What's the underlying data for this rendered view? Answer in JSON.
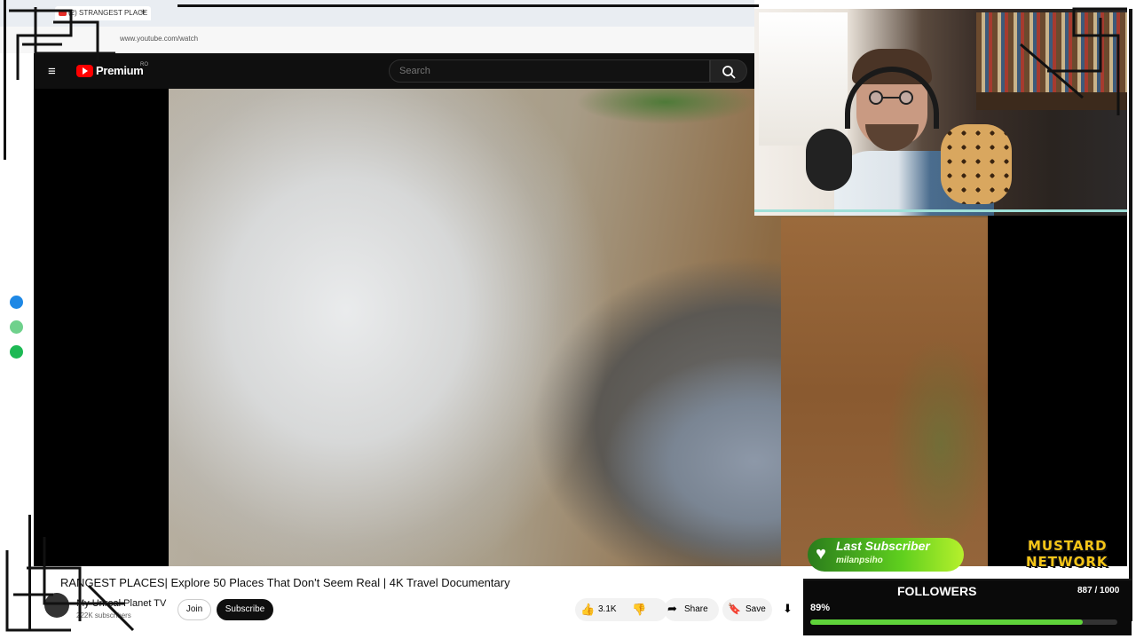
{
  "browser": {
    "tab_title": "(2) STRANGEST PLACE",
    "new_tab": "+",
    "url": "www.youtube.com/watch"
  },
  "youtube": {
    "menu_icon": "≡",
    "logo_text": "Premium",
    "region": "RO",
    "search_placeholder": "Search",
    "video_title": "RANGEST PLACES| Explore 50 Places That Don't Seem Real | 4K Travel Documentary",
    "channel_name": "My Unreal Planet TV",
    "subscribers": "222K subscribers",
    "join_label": "Join",
    "subscribe_label": "Subscribe",
    "likes": "3.1K",
    "share_label": "Share",
    "save_label": "Save"
  },
  "overlay": {
    "last_subscriber_title": "Last Subscriber",
    "last_subscriber_name": "milanpsiho",
    "brand_line1": "MUSTARD",
    "brand_line2": "NETWORK",
    "followers_title": "FOLLOWERS",
    "followers_count": "887 / 1000",
    "followers_percent": "89%",
    "followers_progress": 0.887
  },
  "colors": {
    "accent_green": "#5fd33a",
    "yt_red": "#ff0000",
    "brand_yellow": "#f5c518"
  }
}
